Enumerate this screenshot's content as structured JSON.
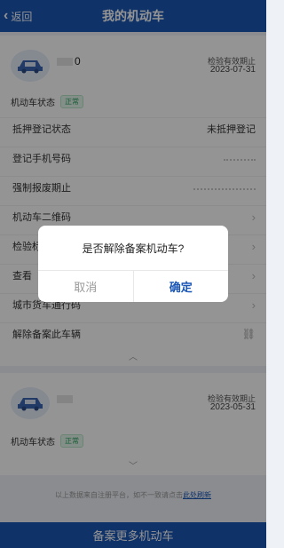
{
  "nav": {
    "back_label": "返回",
    "title": "我的机动车"
  },
  "vehicle1": {
    "plate_visible": "0",
    "inspection_label": "检验有效期止",
    "inspection_date": "2023-07-31",
    "status_label": "机动车状态",
    "status_badge": "正常",
    "rows": [
      {
        "label": "抵押登记状态",
        "value": "未抵押登记"
      },
      {
        "label": "登记手机号码",
        "value": ""
      },
      {
        "label": "强制报废期止",
        "value": ""
      },
      {
        "label": "机动车二维码",
        "value": ""
      },
      {
        "label": "检验标",
        "value": ""
      },
      {
        "label": "查看",
        "value": ""
      },
      {
        "label": "城市货车通行码",
        "value": ""
      },
      {
        "label": "解除备案此车辆",
        "value": ""
      }
    ]
  },
  "vehicle2": {
    "inspection_label": "检验有效期止",
    "inspection_date": "2023-05-31",
    "status_label": "机动车状态",
    "status_badge": "正常"
  },
  "footer": {
    "disclaimer": "以上数据来自注册平台，如不一致请点击",
    "refresh_link": "此处刷新",
    "bottom_button": "备案更多机动车"
  },
  "dialog": {
    "message": "是否解除备案机动车?",
    "cancel_label": "取消",
    "ok_label": "确定"
  },
  "colors": {
    "brand": "#1a56b6",
    "status_green": "#2a9d5c"
  }
}
